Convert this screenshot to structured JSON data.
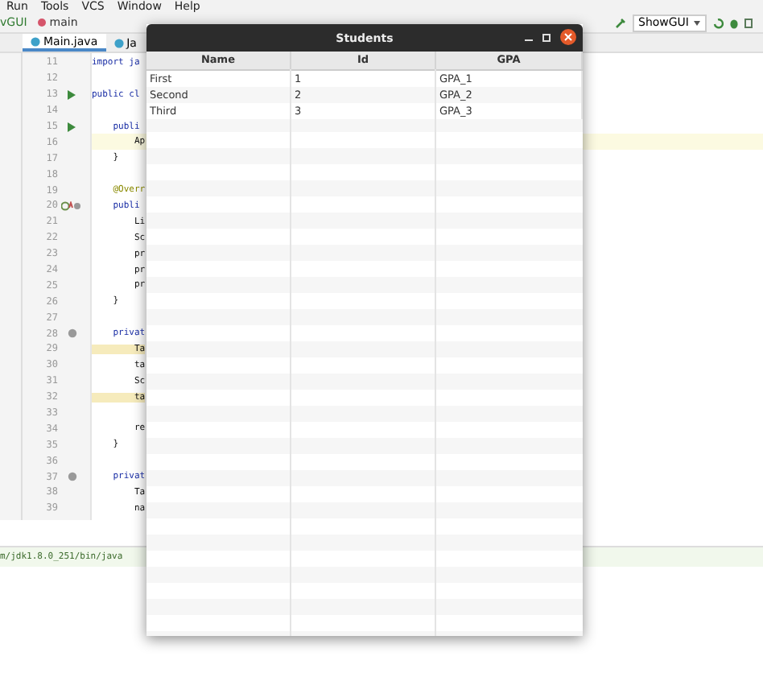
{
  "menu": [
    "Run",
    "Tools",
    "VCS",
    "Window",
    "Help"
  ],
  "navbar": {
    "project": "vGUI",
    "branch": "main"
  },
  "run_config": "ShowGUI",
  "tabs": [
    {
      "label": "Main.java",
      "selected": true
    },
    {
      "label": "Ja",
      "selected": false
    }
  ],
  "editor": {
    "lines": [
      {
        "number": "11",
        "code": "import ja",
        "kind": "keyword",
        "current": false
      },
      {
        "number": "12",
        "current": false
      },
      {
        "number": "13",
        "code": "public cl",
        "kind": "keyword",
        "gutter_icon": {
          "kind": "run"
        },
        "current": false
      },
      {
        "number": "14",
        "current": false
      },
      {
        "number": "15",
        "code": "    publi",
        "kind": "keyword",
        "gutter_icon": {
          "kind": "run"
        },
        "current": false
      },
      {
        "number": "16",
        "code": "        Ap",
        "kind": "plain",
        "current": true
      },
      {
        "number": "17",
        "code": "    }",
        "kind": "plain",
        "current": false
      },
      {
        "number": "18",
        "current": false
      },
      {
        "number": "19",
        "code": "    @Overr",
        "kind": "annotation",
        "current": false
      },
      {
        "number": "20",
        "code": "    publi",
        "kind": "keyword",
        "gutter_icon": {
          "kind": "override"
        },
        "current": false
      },
      {
        "number": "21",
        "code": "        Li",
        "kind": "plain",
        "current": false
      },
      {
        "number": "22",
        "code": "        Sc",
        "kind": "plain",
        "current": false
      },
      {
        "number": "23",
        "code": "        pr",
        "kind": "plain",
        "current": false
      },
      {
        "number": "24",
        "code": "        pr",
        "kind": "plain",
        "current": false
      },
      {
        "number": "25",
        "code": "        pr",
        "kind": "plain",
        "current": false
      },
      {
        "number": "26",
        "code": "    }",
        "kind": "plain",
        "current": false
      },
      {
        "number": "27",
        "current": false
      },
      {
        "number": "28",
        "code": "    privat",
        "kind": "keyword",
        "gutter_icon": {
          "kind": "at"
        },
        "current": false
      },
      {
        "number": "29",
        "code": "        Ta",
        "kind": "highlighted",
        "current": false
      },
      {
        "number": "30",
        "code": "        ta",
        "kind": "plain",
        "current": false
      },
      {
        "number": "31",
        "code": "        Sc",
        "kind": "plain",
        "current": false
      },
      {
        "number": "32",
        "code": "        ta",
        "kind": "highlighted",
        "current": false
      },
      {
        "number": "33",
        "current": false
      },
      {
        "number": "34",
        "code": "        re",
        "kind": "plain",
        "current": false
      },
      {
        "number": "35",
        "code": "    }",
        "kind": "plain",
        "current": false
      },
      {
        "number": "36",
        "current": false
      },
      {
        "number": "37",
        "code": "    privat",
        "kind": "keyword",
        "gutter_icon": {
          "kind": "at"
        },
        "current": false
      },
      {
        "number": "38",
        "code": "        Ta",
        "kind": "plain",
        "current": false
      },
      {
        "number": "39",
        "code": "        na",
        "kind": "plain",
        "current": false
      }
    ]
  },
  "console": "m/jdk1.8.0_251/bin/java",
  "dialog": {
    "title": "Students",
    "columns": [
      "Name",
      "Id",
      "GPA"
    ],
    "rows": [
      [
        "First",
        "1",
        "GPA_1"
      ],
      [
        "Second",
        "2",
        "GPA_2"
      ],
      [
        "Third",
        "3",
        "GPA_3"
      ]
    ]
  }
}
